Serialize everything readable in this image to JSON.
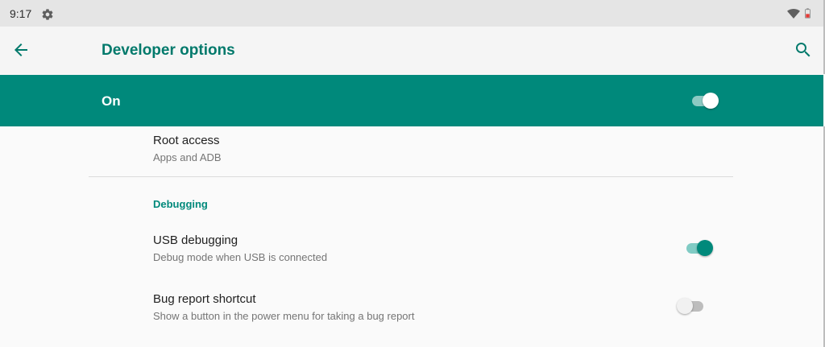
{
  "status_bar": {
    "time": "9:17",
    "icons": [
      "settings-gear-icon",
      "wifi-icon",
      "battery-icon"
    ]
  },
  "app_bar": {
    "title": "Developer options",
    "back_icon": "arrow-back-icon",
    "search_icon": "search-icon"
  },
  "master_switch": {
    "label": "On",
    "checked": true
  },
  "preferences": {
    "root_access": {
      "title": "Root access",
      "summary": "Apps and ADB"
    },
    "debugging_category": "Debugging",
    "usb_debugging": {
      "title": "USB debugging",
      "summary": "Debug mode when USB is connected",
      "checked": true
    },
    "bug_report_shortcut": {
      "title": "Bug report shortcut",
      "summary": "Show a button in the power menu for taking a bug report",
      "checked": false
    }
  },
  "colors": {
    "accent": "#00897b",
    "title_text": "#00796b",
    "status_bar": "#e5e5e5"
  }
}
